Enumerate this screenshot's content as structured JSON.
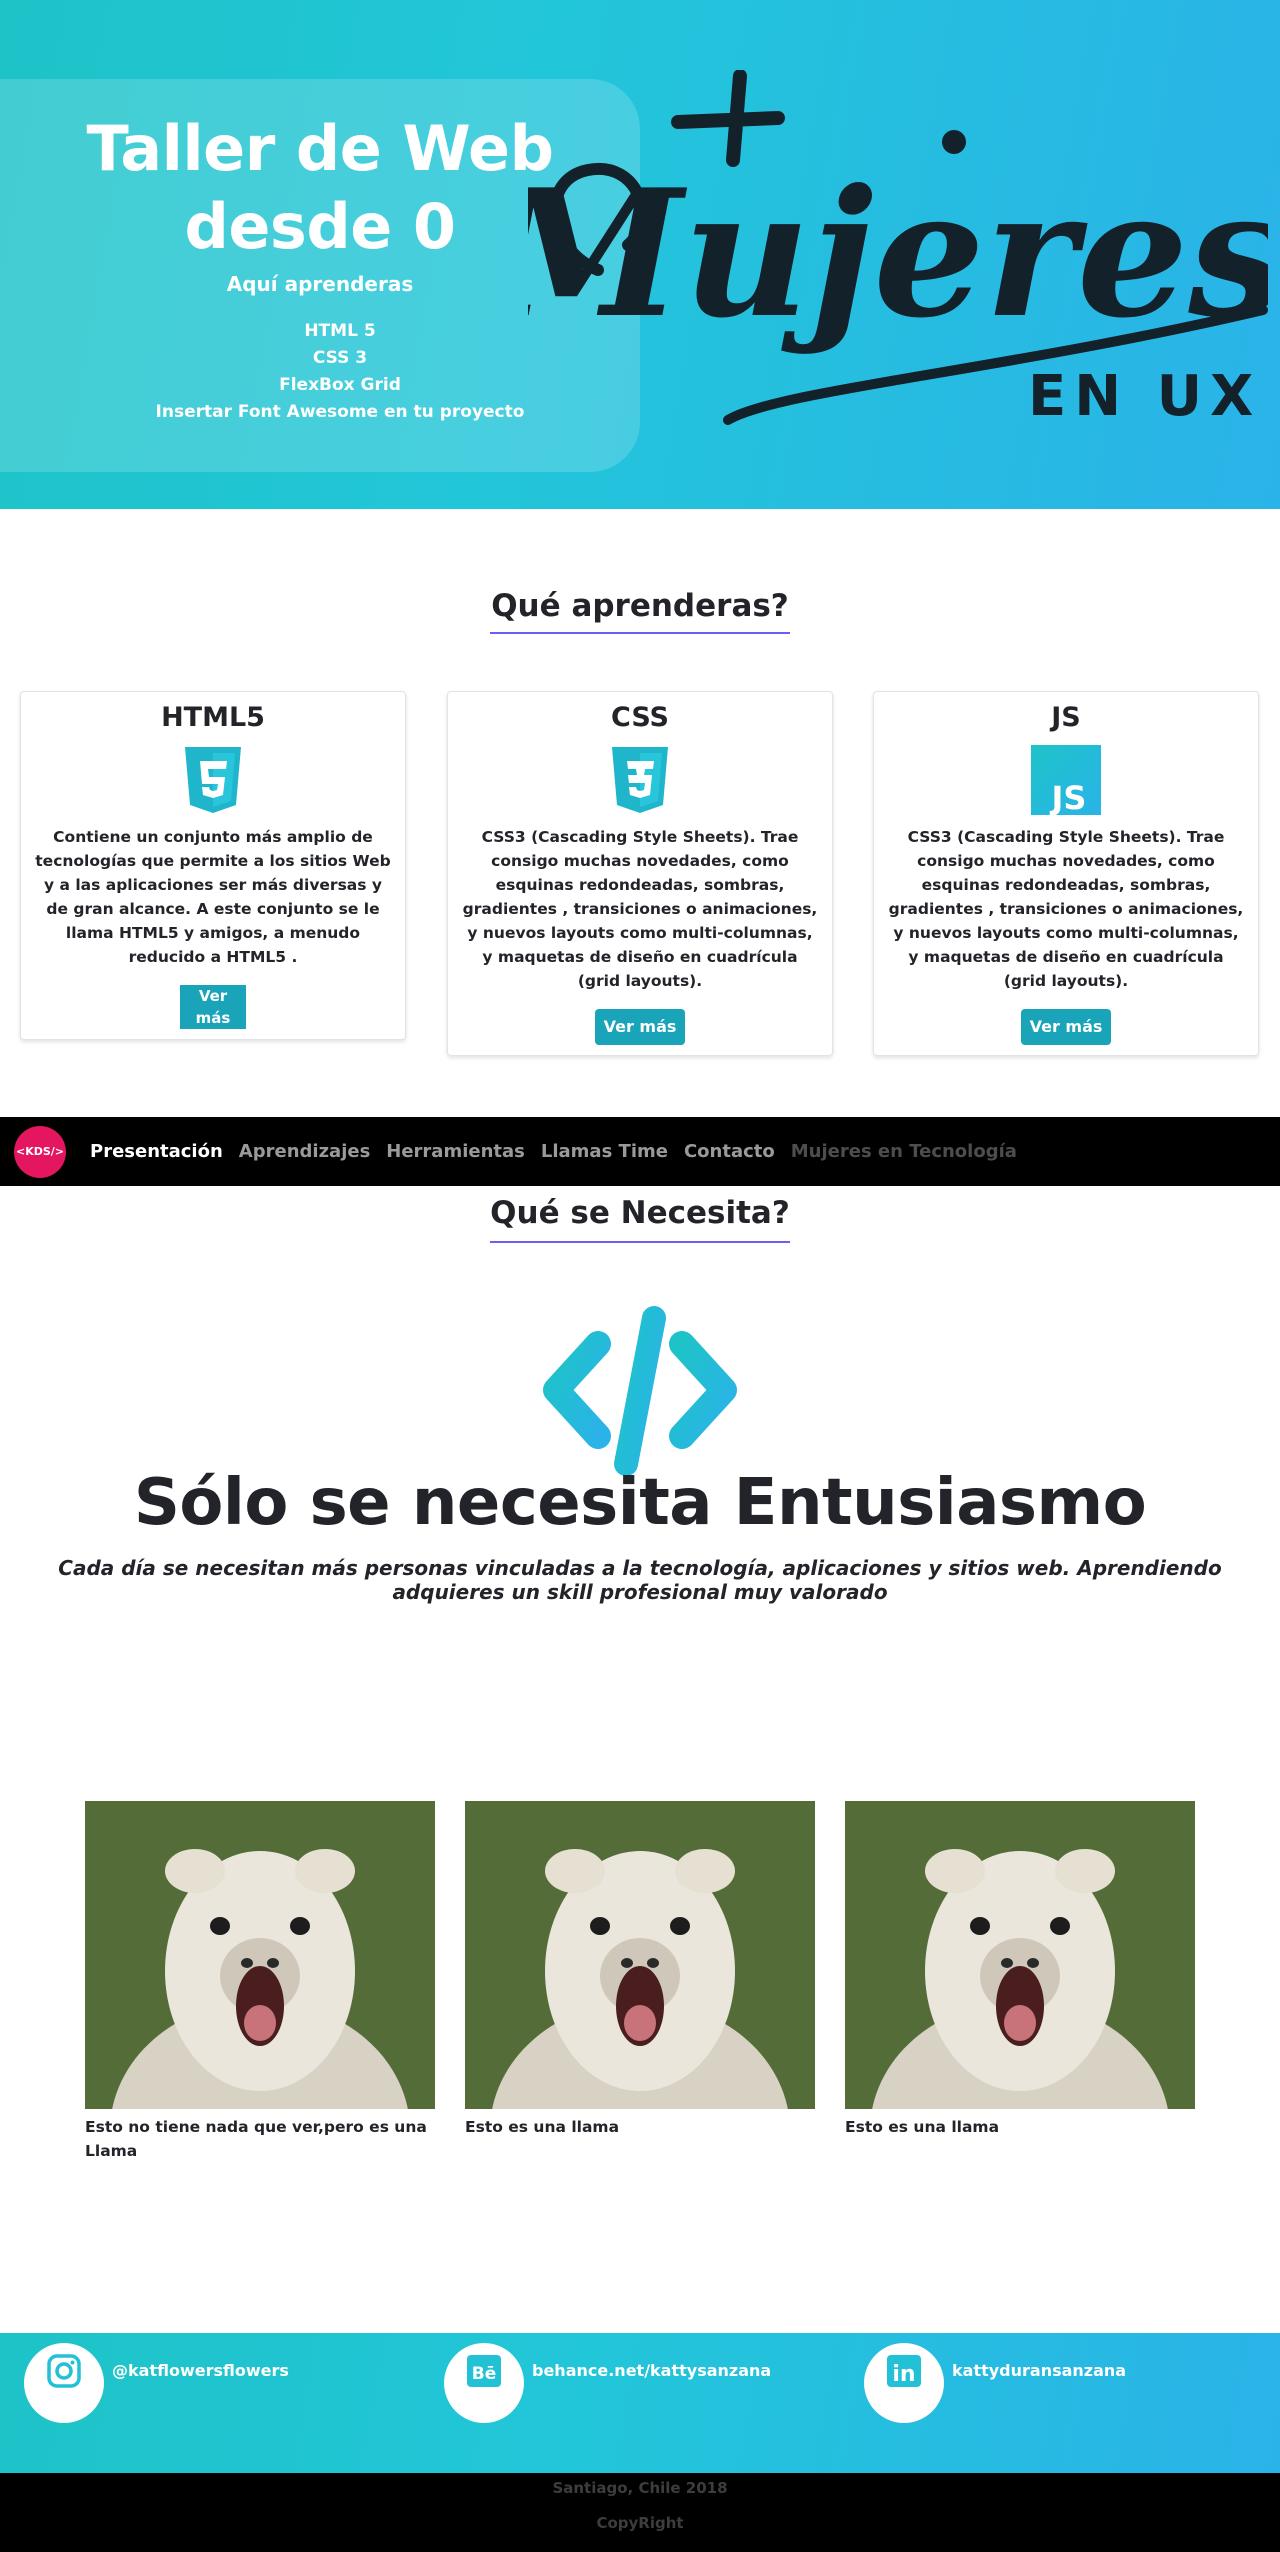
{
  "hero": {
    "title_line1": "Taller de Web",
    "title_line2": "desde 0",
    "subtitle": "Aquí aprenderas",
    "topics": [
      "HTML 5",
      "CSS 3",
      "FlexBox Grid",
      "Insertar Font Awesome en tu proyecto"
    ],
    "logo_text": "Mujeres",
    "logo_sub": "EN UX"
  },
  "learn": {
    "title": "Qué aprenderas?",
    "cards": [
      {
        "title": "HTML5",
        "icon": "html5-icon",
        "text": "Contiene un conjunto más amplio de tecnologías que permite a los sitios Web y a las aplicaciones ser más diversas y de gran alcance. A este conjunto se le llama HTML5 y amigos, a menudo reducido a HTML5 .",
        "button": "Ver más"
      },
      {
        "title": "CSS",
        "icon": "css3-icon",
        "text": "CSS3 (Cascading Style Sheets). Trae consigo muchas novedades, como esquinas redondeadas, sombras, gradientes , transiciones o animaciones, y nuevos layouts como multi-columnas, y maquetas de diseño en cuadrícula (grid layouts).",
        "button": "Ver más"
      },
      {
        "title": "JS",
        "icon": "js-icon",
        "icon_text": "JS",
        "text": "CSS3 (Cascading Style Sheets). Trae consigo muchas novedades, como esquinas redondeadas, sombras, gradientes , transiciones o animaciones, y nuevos layouts como multi-columnas, y maquetas de diseño en cuadrícula (grid layouts).",
        "button": "Ver más"
      }
    ]
  },
  "nav": {
    "logo": "<KDS/>",
    "items": [
      "Presentación",
      "Aprendizajes",
      "Herramientas",
      "Llamas Time",
      "Contacto",
      "Mujeres en Tecnología"
    ]
  },
  "needs": {
    "title": "Qué se Necesita?",
    "headline": "Sólo se necesita Entusiasmo",
    "lead": "Cada día se necesitan más personas vinculadas a la tecnología, aplicaciones y sitios web. Aprendiendo adquieres un skill profesional muy valorado"
  },
  "llamas": [
    {
      "caption": "Esto no tiene nada que ver,pero es una Llama"
    },
    {
      "caption": "Esto es una llama"
    },
    {
      "caption": "Esto es una llama"
    }
  ],
  "footer": {
    "social": [
      {
        "icon": "instagram-icon",
        "label": "@katflowersflowers"
      },
      {
        "icon": "behance-icon",
        "label": "behance.net/kattysanzana",
        "icon_text": "Bē"
      },
      {
        "icon": "linkedin-icon",
        "label": "kattyduransanzana",
        "icon_text": "in"
      }
    ],
    "location": "Santiago, Chile 2018",
    "copyright": "CopyRight"
  },
  "colors": {
    "accent": "#1aa4ba",
    "underline": "#6b5df5",
    "nav_logo": "#e3165f"
  }
}
